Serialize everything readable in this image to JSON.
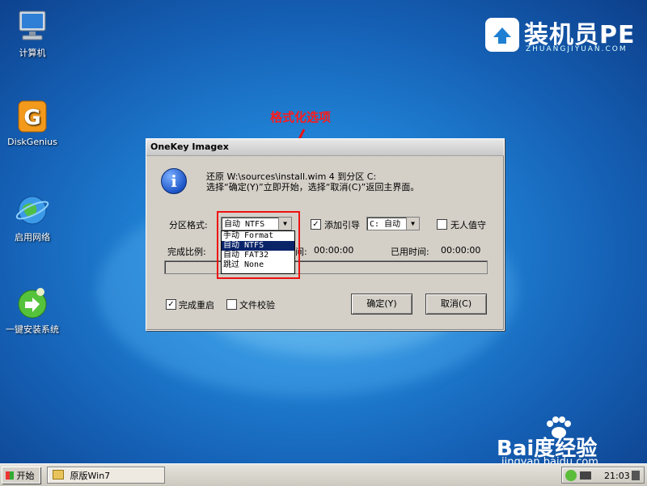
{
  "desktop": {
    "icons": [
      {
        "label": "计算机",
        "icon": "computer-icon"
      },
      {
        "label": "DiskGenius",
        "icon": "diskgenius-icon"
      },
      {
        "label": "启用网络",
        "icon": "network-globe-icon"
      },
      {
        "label": "一键安装系统",
        "icon": "install-system-icon"
      }
    ]
  },
  "logo": {
    "title": "装机员PE",
    "subtitle": "ZHUANGJIYUAN.COM"
  },
  "annotation": "格式化选项",
  "dialog": {
    "title": "OneKey Imagex",
    "message_line1": "还原 W:\\sources\\install.wim 4 到分区 C:",
    "message_line2": "选择“确定(Y)”立即开始，选择“取消(C)”返回主界面。",
    "format_label": "分区格式:",
    "format_value": "自动 NTFS",
    "format_options": [
      "手动 Format",
      "自动 NTFS",
      "自动 FAT32",
      "跳过 None"
    ],
    "boot_label": "添加引导",
    "boot_value": "C: 自动",
    "unattended_label": "无人值守",
    "progress_label": "完成比例:",
    "remaining_label": "间:",
    "remaining_value": "00:00:00",
    "elapsed_label": "已用时间:",
    "elapsed_value": "00:00:00",
    "progress": 0,
    "reboot_label": "完成重启",
    "verify_label": "文件校验",
    "ok_label": "确定(Y)",
    "cancel_label": "取消(C)",
    "add_boot_checked": true,
    "unattended_checked": false,
    "reboot_checked": true,
    "verify_checked": false
  },
  "taskbar": {
    "start_label": "开始",
    "task_label": "原版Win7",
    "clock": "21:03"
  },
  "watermark": {
    "brand": "Bai度经验",
    "url": "jingyan.baidu.com"
  },
  "colors": {
    "accent": "#0a246a",
    "annotation": "#e11111"
  }
}
